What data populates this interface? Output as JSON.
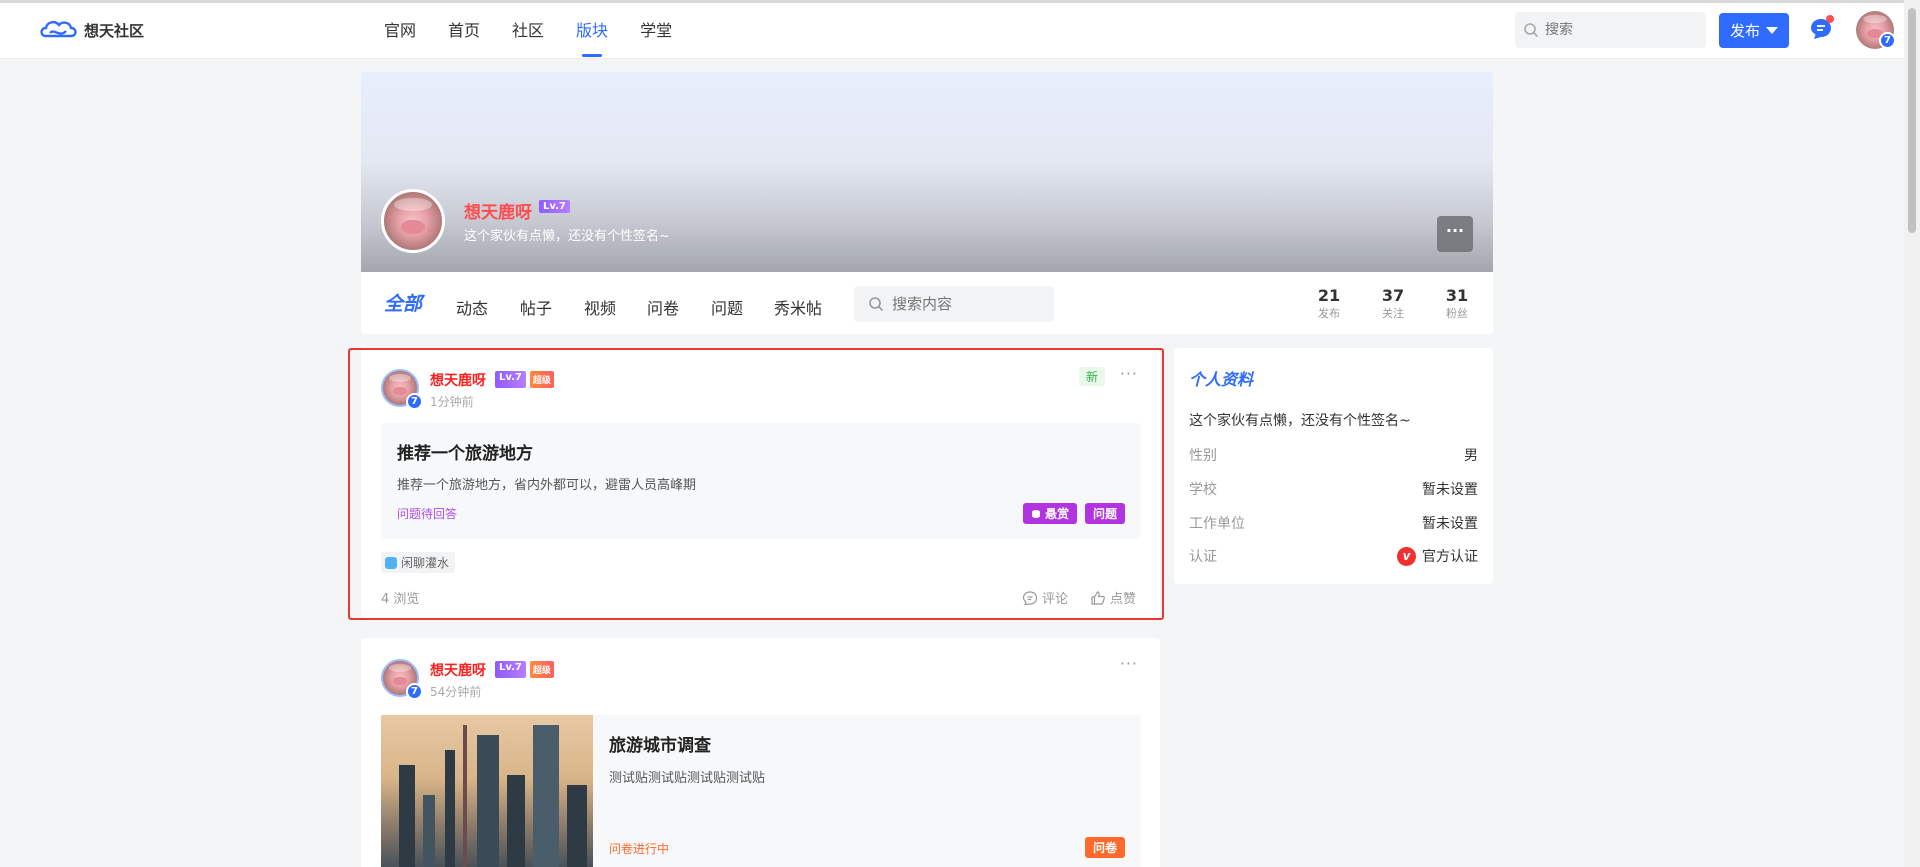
{
  "header": {
    "logo_text": "想天社区",
    "nav": [
      "官网",
      "首页",
      "社区",
      "版块",
      "学堂"
    ],
    "active_nav": "版块",
    "search_placeholder": "搜索",
    "publish_label": "发布",
    "user_level": "7"
  },
  "profile": {
    "name": "想天鹿呀",
    "level_tag": "Lv.7",
    "signature": "这个家伙有点懒，还没有个性签名~",
    "more_label": "···",
    "tabs": [
      "全部",
      "动态",
      "帖子",
      "视频",
      "问卷",
      "问题",
      "秀米帖"
    ],
    "search_placeholder": "搜索内容",
    "stats": [
      {
        "num": "21",
        "label": "发布"
      },
      {
        "num": "37",
        "label": "关注"
      },
      {
        "num": "31",
        "label": "粉丝"
      }
    ]
  },
  "posts": [
    {
      "author": "想天鹿呀",
      "level_tag": "Lv.7",
      "super_tag": "超级",
      "avatar_level": "7",
      "time": "1分钟前",
      "new_label": "新",
      "title": "推荐一个旅游地方",
      "desc": "推荐一个旅游地方，省内外都可以，避雷人员高峰期",
      "status": "问题待回答",
      "badges": [
        "悬赏",
        "问题"
      ],
      "topic": "闲聊灌水",
      "views": "4 浏览",
      "comment_label": "评论",
      "like_label": "点赞"
    },
    {
      "author": "想天鹿呀",
      "level_tag": "Lv.7",
      "super_tag": "超级",
      "avatar_level": "7",
      "time": "54分钟前",
      "title": "旅游城市调查",
      "desc": "测试贴测试贴测试贴测试贴",
      "status": "问卷进行中",
      "badge": "问卷"
    }
  ],
  "sidebar": {
    "title": "个人资料",
    "signature": "这个家伙有点懒，还没有个性签名~",
    "rows": [
      {
        "key": "性别",
        "value": "男"
      },
      {
        "key": "学校",
        "value": "暂未设置"
      },
      {
        "key": "工作单位",
        "value": "暂未设置"
      },
      {
        "key": "认证",
        "value": "官方认证"
      }
    ],
    "verify_icon": "v"
  },
  "colors": {
    "accent": "#2f6bff",
    "name_red": "#ff1f1f",
    "question_purple": "#b233e0",
    "survey_orange": "#ff6a2c",
    "highlight_border": "#e53935"
  }
}
